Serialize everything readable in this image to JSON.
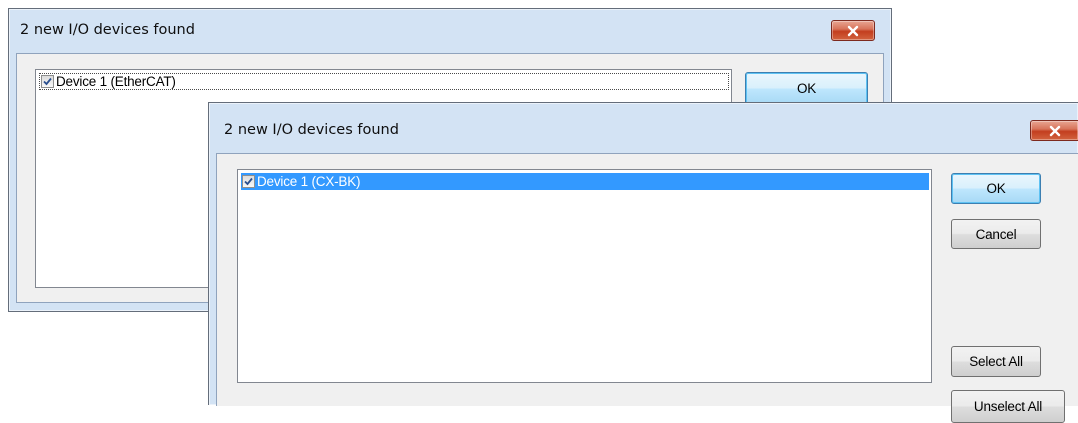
{
  "dialog_back": {
    "title": "2 new I/O devices found",
    "devices": [
      {
        "label": "Device 1 (EtherCAT)",
        "checked": true,
        "selected": false,
        "focused": true
      }
    ],
    "ok_label": "OK"
  },
  "dialog_front": {
    "title": "2 new I/O devices found",
    "devices": [
      {
        "label": "Device 1 (CX-BK)",
        "checked": true,
        "selected": true,
        "focused": false
      }
    ],
    "ok_label": "OK",
    "cancel_label": "Cancel",
    "select_all_label": "Select All",
    "unselect_all_label": "Unselect All"
  },
  "icons": {
    "close": "close-icon",
    "checkmark": "checkmark-icon"
  },
  "colors": {
    "selection": "#3399ff",
    "window_frame": "#d3e3f4",
    "close_button": "#c33e1f",
    "default_button_border": "#3c7fb1"
  }
}
